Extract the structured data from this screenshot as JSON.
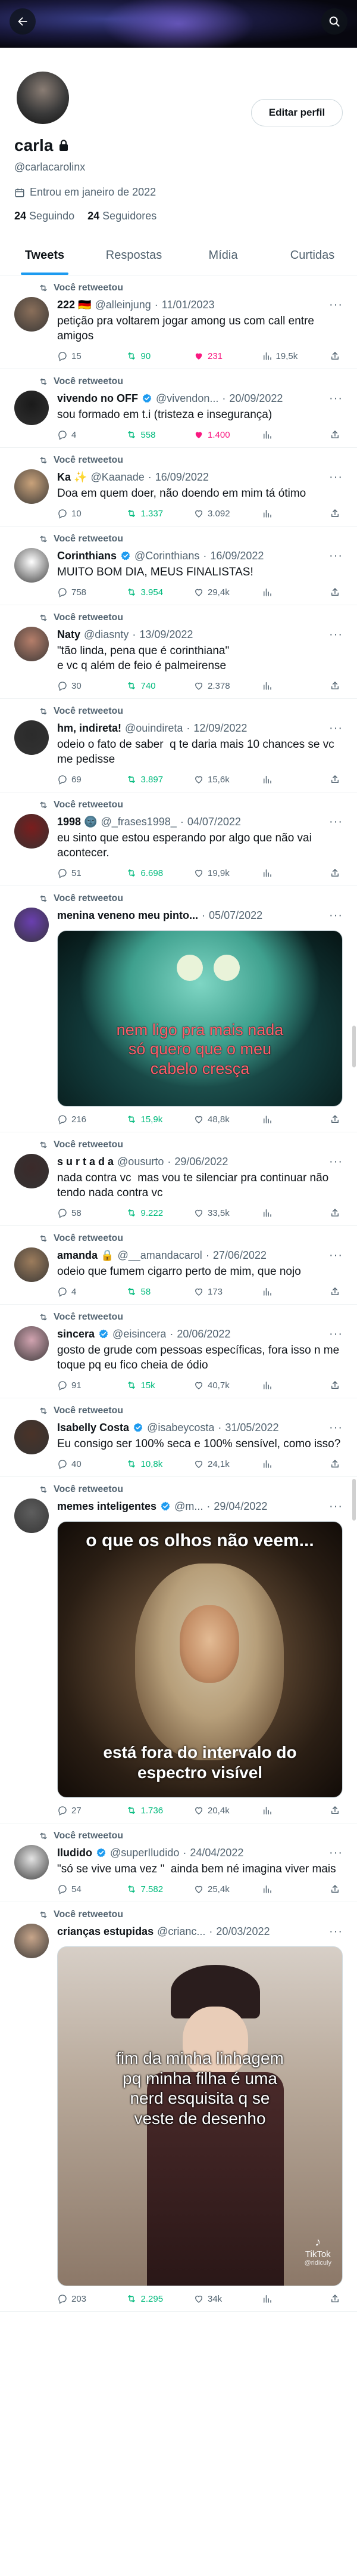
{
  "header": {
    "back_icon": "arrow-left-icon",
    "search_icon": "search-icon"
  },
  "profile": {
    "name": "carla",
    "handle": "@carlacarolinx",
    "joined": "Entrou em janeiro de 2022",
    "following_count": "24",
    "following_label": "Seguindo",
    "followers_count": "24",
    "followers_label": "Seguidores",
    "edit_button": "Editar perfil"
  },
  "tabs": [
    {
      "label": "Tweets"
    },
    {
      "label": "Respostas"
    },
    {
      "label": "Mídia"
    },
    {
      "label": "Curtidas"
    }
  ],
  "retweet_label": "Você retweetou",
  "tweets": [
    {
      "name": "222 🇩🇪",
      "handle": "@alleinjung",
      "date": "11/01/2023",
      "text": "petição pra voltarem jogar among us com call entre amigos",
      "replies": "15",
      "retweets": "90",
      "likes": "231",
      "views": "19,5k",
      "liked": true,
      "verified": false,
      "avatar_color": "#8a6f5a"
    },
    {
      "name": "vivendo no OFF",
      "handle": "@vivendon...",
      "date": "20/09/2022",
      "text": "sou formado em t.i (tristeza e insegurança)",
      "replies": "4",
      "retweets": "558",
      "likes": "1.400",
      "views": "",
      "liked": true,
      "verified": true,
      "avatar_color": "#1a1a1a"
    },
    {
      "name": "Ka ✨",
      "handle": "@Kaanade",
      "date": "16/09/2022",
      "text": "Doa em quem doer, não doendo em mim tá ótimo",
      "replies": "10",
      "retweets": "1.337",
      "likes": "3.092",
      "views": "",
      "liked": false,
      "verified": false,
      "avatar_color": "#c9a27a"
    },
    {
      "name": "Corinthians",
      "handle": "@Corinthians",
      "date": "16/09/2022",
      "text": "MUITO BOM DIA, MEUS FINALISTAS!",
      "replies": "758",
      "retweets": "3.954",
      "likes": "29,4k",
      "views": "",
      "liked": false,
      "verified": true,
      "avatar_color": "#ffffff"
    },
    {
      "name": "Naty",
      "handle": "@diasnty",
      "date": "13/09/2022",
      "text": "\"tão linda, pena que é corinthiana\"\ne vc q além de feio é palmeirense",
      "replies": "30",
      "retweets": "740",
      "likes": "2.378",
      "views": "",
      "liked": false,
      "verified": false,
      "avatar_color": "#b57e6a"
    },
    {
      "name": "hm, indireta!",
      "handle": "@ouindireta",
      "date": "12/09/2022",
      "text": "odeio o fato de saber  q te daria mais 10 chances se vc me pedisse",
      "replies": "69",
      "retweets": "3.897",
      "likes": "15,6k",
      "views": "",
      "liked": false,
      "verified": false,
      "avatar_color": "#2b2b2b"
    },
    {
      "name": "1998 🌚",
      "handle": "@_frases1998_",
      "date": "04/07/2022",
      "text": "eu sinto que estou esperando por algo que não vai acontecer.",
      "replies": "51",
      "retweets": "6.698",
      "likes": "19,9k",
      "views": "",
      "liked": false,
      "verified": false,
      "avatar_color": "#7a1d1d"
    },
    {
      "name": "menina veneno meu pinto...",
      "handle": "",
      "date": "05/07/2022",
      "text": "",
      "media": "mike",
      "media_text": "nem ligo pra mais nada\nsó quero que o meu\ncabelo cresça",
      "replies": "216",
      "retweets": "15,9k",
      "likes": "48,8k",
      "views": "",
      "liked": false,
      "verified": false,
      "avatar_color": "#6a3fb0"
    },
    {
      "name": "s u r t a d a",
      "handle": "@ousurto",
      "date": "29/06/2022",
      "text": "nada contra vc  mas vou te silenciar pra continuar não tendo nada contra vc",
      "replies": "58",
      "retweets": "9.222",
      "likes": "33,5k",
      "views": "",
      "liked": false,
      "verified": false,
      "avatar_color": "#3b2a2a"
    },
    {
      "name": "amanda 🔒",
      "handle": "@__amandacarol",
      "date": "27/06/2022",
      "text": "odeio que fumem cigarro perto de mim, que nojo",
      "replies": "4",
      "retweets": "58",
      "likes": "173",
      "views": "",
      "liked": false,
      "verified": false,
      "avatar_color": "#9c7c5c"
    },
    {
      "name": "sincera",
      "handle": "@eisincera",
      "date": "20/06/2022",
      "text": "gosto de grude com pessoas específicas, fora isso n me toque pq eu fico cheia de ódio",
      "replies": "91",
      "retweets": "15k",
      "likes": "40,7k",
      "views": "",
      "liked": false,
      "verified": true,
      "avatar_color": "#d1a3b0"
    },
    {
      "name": "Isabelly Costa",
      "handle": "@isabeycosta",
      "date": "31/05/2022",
      "text": "Eu consigo ser 100% seca e 100% sensível, como isso?",
      "replies": "40",
      "retweets": "10,8k",
      "likes": "24,1k",
      "views": "",
      "liked": false,
      "verified": true,
      "avatar_color": "#4a3328"
    },
    {
      "name": "memes inteligentes",
      "handle": "@m...",
      "date": "29/04/2022",
      "text": "",
      "media": "newton",
      "media_text_top": "o que os olhos não veem...",
      "media_text_bottom": "está fora do intervalo do\nespectro visível",
      "replies": "27",
      "retweets": "1.736",
      "likes": "20,4k",
      "views": "",
      "liked": false,
      "verified": true,
      "avatar_color": "#5e5e5e"
    },
    {
      "name": "Iludido",
      "handle": "@superIludido",
      "date": "24/04/2022",
      "text": "\"só se vive uma vez \"  ainda bem né imagina viver mais",
      "replies": "54",
      "retweets": "7.582",
      "likes": "25,4k",
      "views": "",
      "liked": false,
      "verified": true,
      "avatar_color": "#e3e3e3"
    },
    {
      "name": "crianças estupidas",
      "handle": "@crianc...",
      "date": "20/03/2022",
      "text": "",
      "media": "cosplay",
      "media_text": "fim da minha linhagem\npq minha filha é uma\nnerd esquisita q se\nveste de desenho",
      "media_watermark": "TikTok",
      "media_watermark_sub": "@ridiculy",
      "replies": "203",
      "retweets": "2.295",
      "likes": "34k",
      "views": "",
      "liked": false,
      "verified": false,
      "avatar_color": "#c7a58a"
    }
  ],
  "colors": {
    "accent": "#1d9bf0",
    "retweet": "#00ba7c",
    "like": "#f91880",
    "muted": "#536471"
  }
}
